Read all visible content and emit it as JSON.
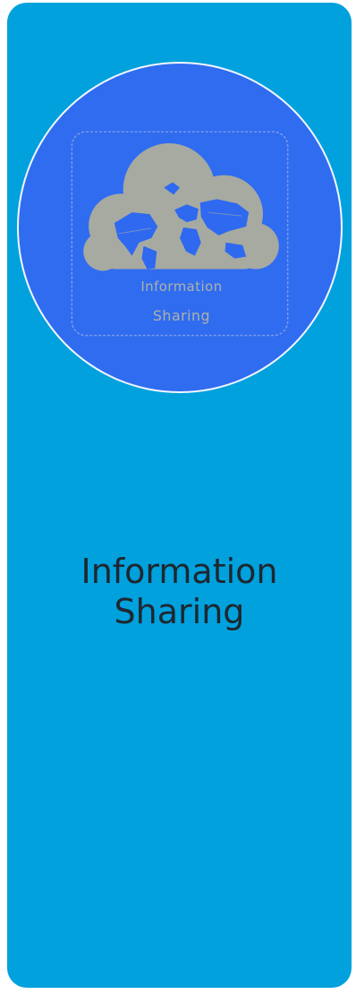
{
  "card": {
    "title": "Information\nSharing",
    "background_color": "#00a1dd",
    "title_color": "#1e2730"
  },
  "avatar": {
    "icon": "cloud-world-map-icon",
    "background_color": "#2f6cf0",
    "caption": "Information Sharing"
  }
}
